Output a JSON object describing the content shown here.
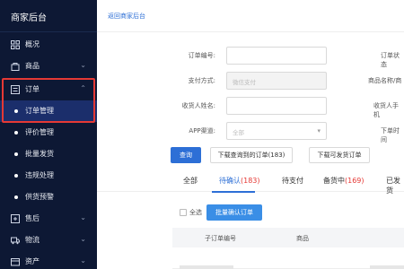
{
  "app": {
    "title": "商家后台"
  },
  "header": {
    "back_link": "返回商家后台"
  },
  "sidebar": {
    "items": [
      {
        "label": "概况",
        "icon": "grid-icon",
        "chevron": ""
      },
      {
        "label": "商品",
        "icon": "bag-icon",
        "chevron": "⌄"
      },
      {
        "label": "订单",
        "icon": "list-icon",
        "chevron": "⌃"
      },
      {
        "label": "售后",
        "icon": "return-icon",
        "chevron": "⌄"
      },
      {
        "label": "物流",
        "icon": "truck-icon",
        "chevron": "⌄"
      },
      {
        "label": "资产",
        "icon": "wallet-icon",
        "chevron": "⌄"
      }
    ],
    "order_sub_items": [
      {
        "label": "订单管理",
        "active": true
      },
      {
        "label": "评价管理",
        "active": false
      },
      {
        "label": "批量发货",
        "active": false
      },
      {
        "label": "违规处理",
        "active": false
      },
      {
        "label": "供货预警",
        "active": false
      }
    ]
  },
  "filters": {
    "order_no_label": "订单编号:",
    "pay_method_label": "支付方式:",
    "pay_method_value": "微信支付",
    "receiver_label": "收货人姓名:",
    "app_channel_label": "APP渠道:",
    "app_channel_value": "全部",
    "right_status_label": "订单状态",
    "right_product_label": "商品名称/商",
    "right_phone_label": "收货人手机",
    "right_order_time_label": "下单时间"
  },
  "actions": {
    "query": "查询",
    "download_query": "下载查询到的订单(183)",
    "download_shippable": "下载可发货订单"
  },
  "tabs": [
    {
      "label": "全部",
      "count": ""
    },
    {
      "label": "待确认",
      "count": "(183)"
    },
    {
      "label": "待支付",
      "count": ""
    },
    {
      "label": "备货中",
      "count": "(169)"
    },
    {
      "label": "已发货",
      "count": ""
    }
  ],
  "bulk": {
    "select_all": "全选",
    "confirm_button": "批量确认订单"
  },
  "table": {
    "headers": [
      "子订单编号",
      "商品"
    ]
  },
  "colors": {
    "sidebar_bg": "#0d1834",
    "primary": "#2d6fd6",
    "alert": "#e53935"
  }
}
